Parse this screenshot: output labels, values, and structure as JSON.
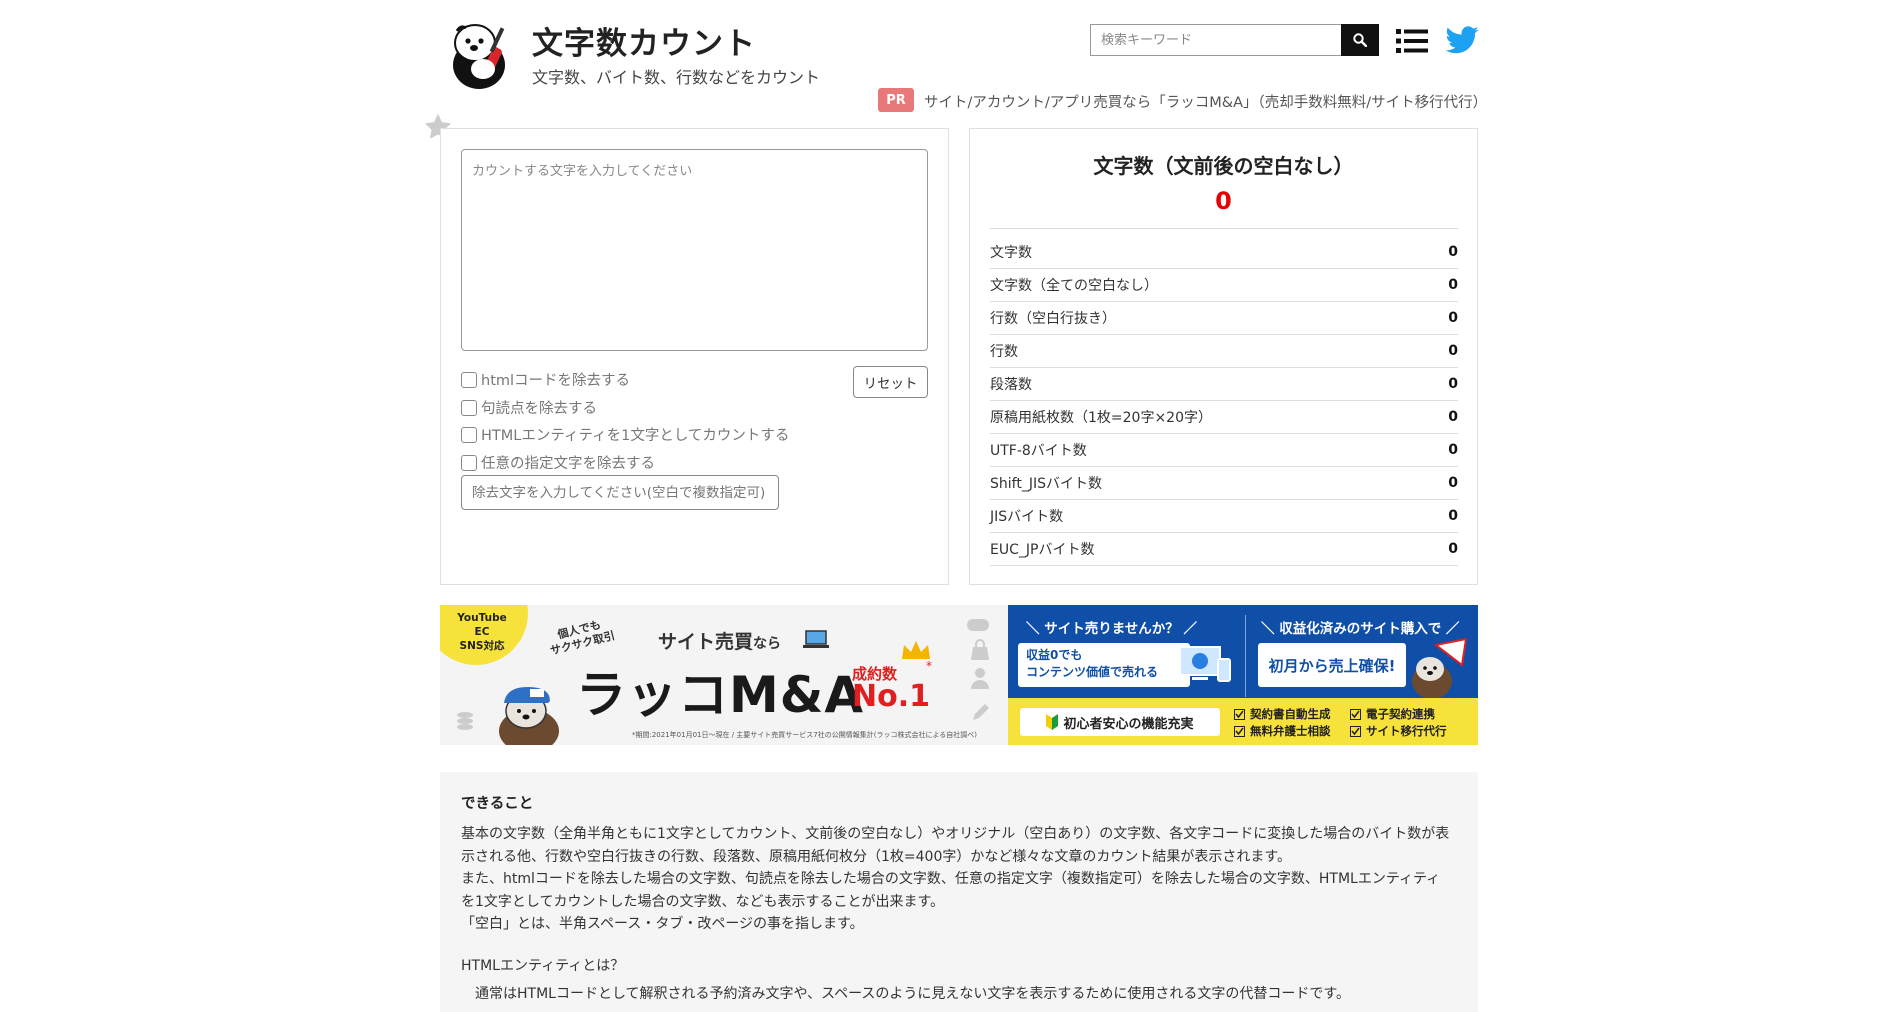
{
  "header": {
    "title": "文字数カウント",
    "subtitle": "文字数、バイト数、行数などをカウント",
    "search_placeholder": "検索キーワード"
  },
  "pr": {
    "badge": "PR",
    "text": "サイト/アカウント/アプリ売買なら「ラッコM&A」（売却手数料無料/サイト移行代行）"
  },
  "input": {
    "placeholder": "カウントする文字を入力してください",
    "options": [
      "htmlコードを除去する",
      "句読点を除去する",
      "HTMLエンティティを1文字としてカウントする",
      "任意の指定文字を除去する"
    ],
    "reset_label": "リセット",
    "remove_placeholder": "除去文字を入力してください(空白で複数指定可)"
  },
  "results": {
    "main_label": "文字数（文前後の空白なし）",
    "main_value": "0",
    "rows": [
      {
        "label": "文字数",
        "value": "0"
      },
      {
        "label": "文字数（全ての空白なし）",
        "value": "0"
      },
      {
        "label": "行数（空白行抜き）",
        "value": "0"
      },
      {
        "label": "行数",
        "value": "0"
      },
      {
        "label": "段落数",
        "value": "0"
      },
      {
        "label": "原稿用紙枚数（1枚=20字×20字）",
        "value": "0"
      },
      {
        "label": "UTF-8バイト数",
        "value": "0"
      },
      {
        "label": "Shift_JISバイト数",
        "value": "0"
      },
      {
        "label": "JISバイト数",
        "value": "0"
      },
      {
        "label": "EUC_JPバイト数",
        "value": "0"
      }
    ]
  },
  "banner": {
    "badge": [
      "YouTube",
      "EC",
      "SNS対応"
    ],
    "catch": [
      "個人でも",
      "サクサク取引"
    ],
    "tagline_1": "サイト売買",
    "tagline_2": "なら",
    "brand": "ラッコM&A",
    "rank_label": "成約数",
    "rank_value": "No.1",
    "rank_mark": "*",
    "footnote": "*期間:2021年01月01日〜現在 / 主要サイト売買サービス7社の公開情報集計(ラッコ株式会社による自社調べ)",
    "sell_head": "＼ サイト売りませんか？ ／",
    "buy_head": "＼ 収益化済みのサイト購入で ／",
    "sell_box": [
      "収益0でも",
      "コンテンツ価値で売れる"
    ],
    "buy_box": "初月から売上確保!",
    "beginner": "初心者安心の機能充実",
    "features": [
      "契約書自動生成",
      "電子契約連携",
      "無料弁護士相談",
      "サイト移行代行"
    ]
  },
  "info": {
    "title": "できること",
    "paragraph_1": [
      "基本の文字数（全角半角ともに1文字としてカウント、文前後の空白なし）やオリジナル（空白あり）の文字数、各文字コードに変換した場合のバイト数が表",
      "示される他、行数や空白行抜きの行数、段落数、原稿用紙何枚分（1枚=400字）かなど様々な文章のカウント結果が表示されます。",
      "また、htmlコードを除去した場合の文字数、句読点を除去した場合の文字数、任意の指定文字（複数指定可）を除去した場合の文字数、HTMLエンティティ",
      "を1文字としてカウントした場合の文字数、なども表示することが出来ます。",
      "「空白」とは、半角スペース・タブ・改ページの事を指します。"
    ],
    "subheading": "HTMLエンティティとは？",
    "paragraph_2": "　通常はHTMLコードとして解釈される予約済み文字や、スペースのように見えない文字を表示するために使用される文字の代替コードです。"
  },
  "colors": {
    "accent_red": "#e60000",
    "pr_badge": "#e8797a",
    "banner_blue": "#0f4fa8",
    "banner_yellow": "#f7e23b",
    "twitter": "#1da1f2"
  }
}
